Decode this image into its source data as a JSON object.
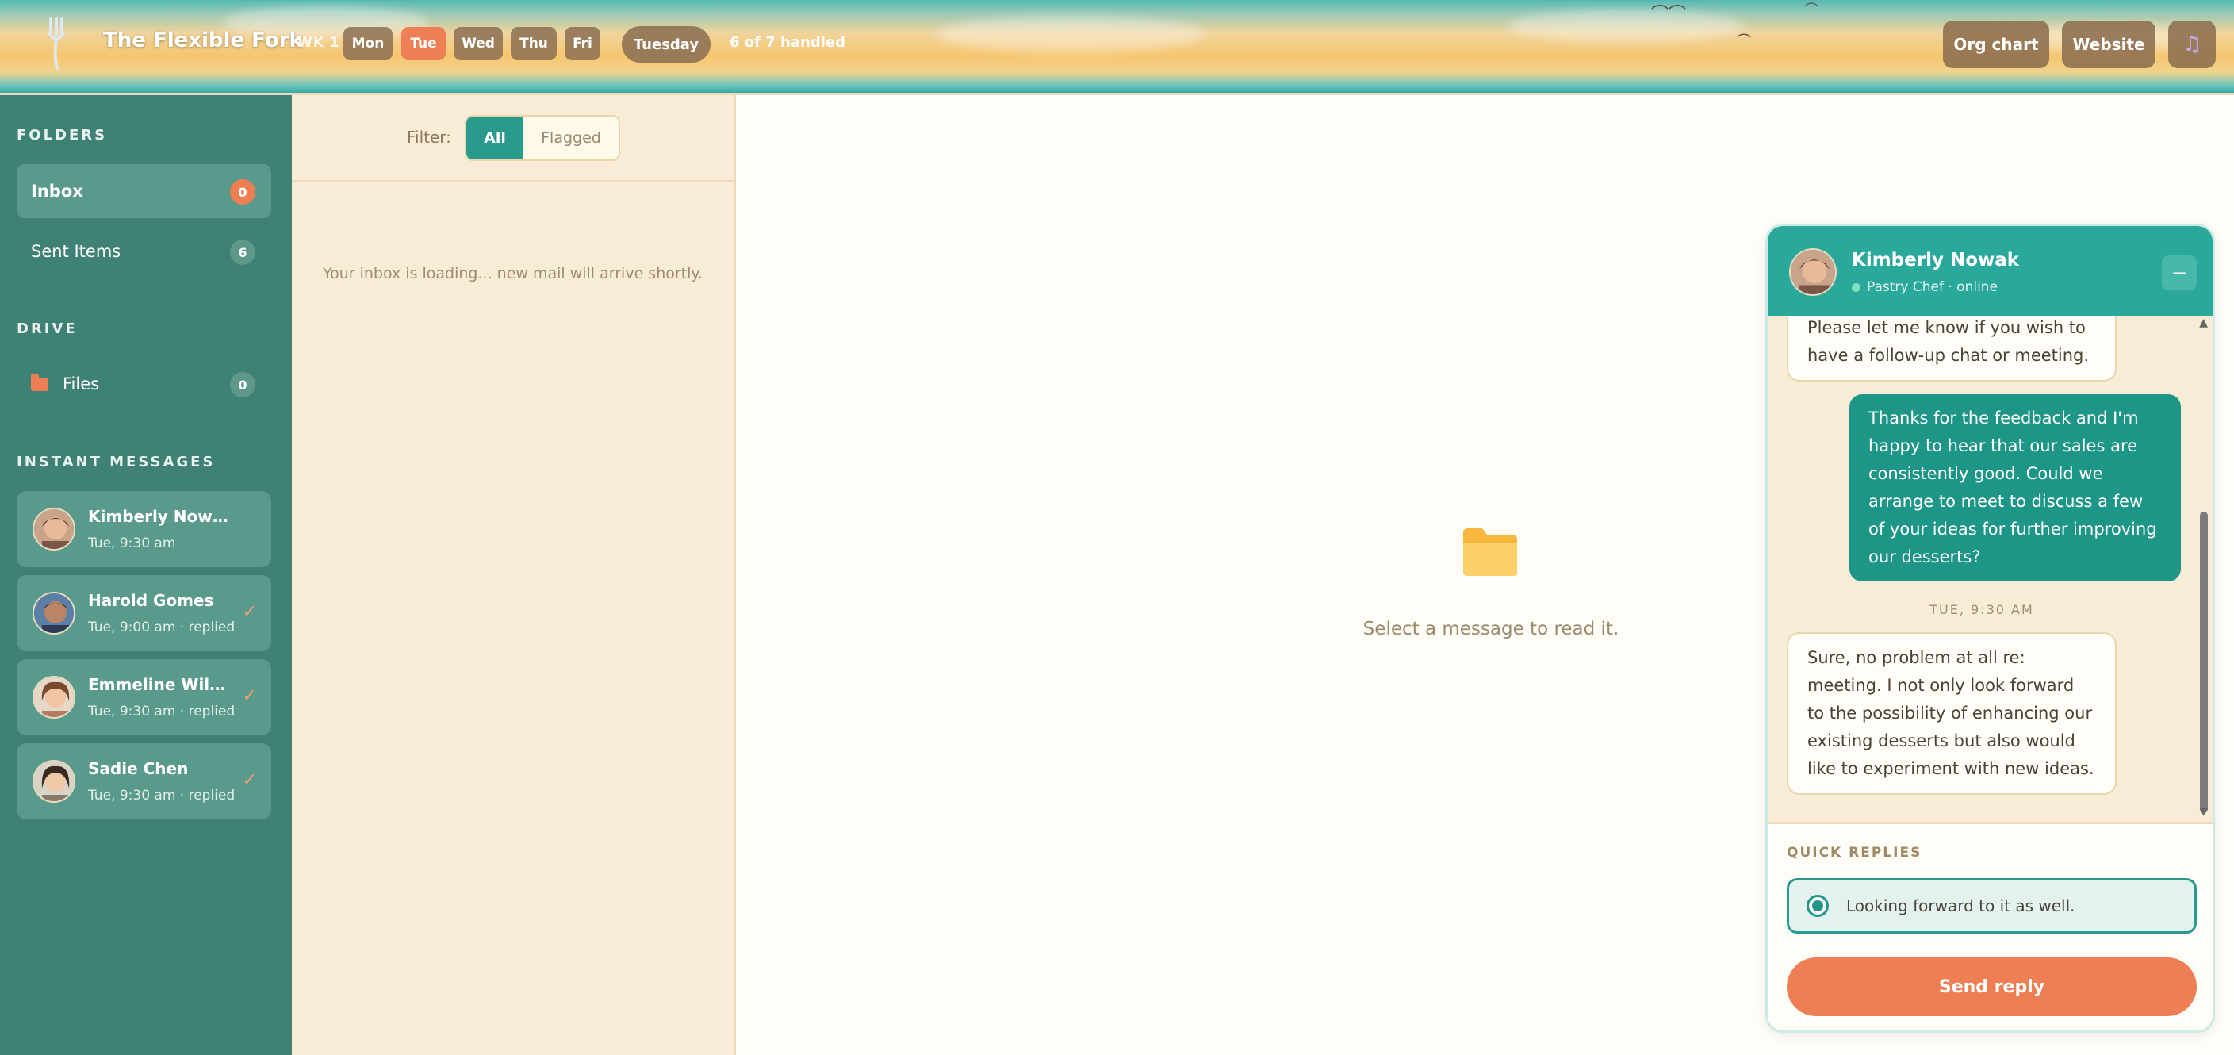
{
  "header": {
    "title": "The Flexible Fork",
    "week_label": "WK 1",
    "days": [
      {
        "label": "Mon",
        "active": false
      },
      {
        "label": "Tue",
        "active": true
      },
      {
        "label": "Wed",
        "active": false
      },
      {
        "label": "Thu",
        "active": false
      },
      {
        "label": "Fri",
        "active": false
      }
    ],
    "current_day": "Tuesday",
    "handled": "6 of 7 handled",
    "buttons": {
      "org_chart": "Org chart",
      "website": "Website",
      "music_icon": "music-note-icon"
    }
  },
  "sidebar": {
    "folders_title": "FOLDERS",
    "folders": [
      {
        "label": "Inbox",
        "count": "0"
      },
      {
        "label": "Sent Items",
        "count": "6"
      }
    ],
    "drive_title": "DRIVE",
    "drive": [
      {
        "label": "Files",
        "count": "0"
      }
    ],
    "im_title": "INSTANT MESSAGES",
    "messages": [
      {
        "name": "Kimberly Nowak",
        "time": "Tue, 9:30 am",
        "replied": false
      },
      {
        "name": "Harold Gomes",
        "time": "Tue, 9:00 am · replied",
        "replied": true
      },
      {
        "name": "Emmeline Willia...",
        "time": "Tue, 9:30 am · replied",
        "replied": true
      },
      {
        "name": "Sadie Chen",
        "time": "Tue, 9:30 am · replied",
        "replied": true
      }
    ]
  },
  "list": {
    "filter_label": "Filter:",
    "filter_all": "All",
    "filter_flagged": "Flagged",
    "empty_text": "Your inbox is loading... new mail will arrive shortly."
  },
  "reader": {
    "empty_text": "Select a message to read it."
  },
  "chat": {
    "name": "Kimberly Nowak",
    "role": "Pastry Chef · online",
    "minimize": "−",
    "messages": [
      {
        "from": "them",
        "text": "Please let me know if you wish to have a follow-up chat or meeting."
      },
      {
        "from": "me",
        "text": "Thanks for the feedback and I'm happy to hear that our sales are consistently good. Could we arrange to meet to discuss a few of your ideas for further improving our desserts?"
      },
      {
        "from": "them",
        "text": "Sure, no problem at all re: meeting. I not only look forward to the possibility of enhancing our existing desserts but also would like to experiment with new ideas."
      }
    ],
    "timestamp": "TUE, 9:30 AM",
    "quick_title": "QUICK REPLIES",
    "quick_option": "Looking forward to it as well.",
    "send_label": "Send reply"
  }
}
